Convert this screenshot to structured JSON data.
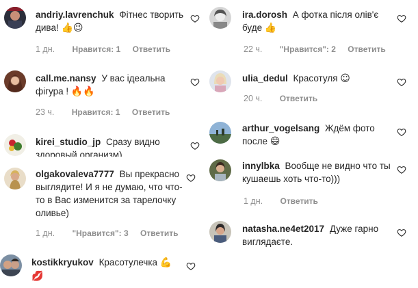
{
  "left": [
    {
      "username": "andriy.lavrenchuk",
      "text": "Фітнес творить дива!",
      "emoji": "👍😉",
      "time": "1 дн.",
      "likes": "Нравится: 1",
      "reply": "Ответить"
    },
    {
      "username": "call.me.nansy",
      "text": "У вас ідеальна фігура !",
      "emoji": "🔥🔥",
      "time": "23 ч.",
      "likes": "Нравится: 1",
      "reply": "Ответить"
    },
    {
      "username": "kirei_studio_jp",
      "text": "Сразу видно здоровый организм)"
    },
    {
      "username": "olgakovaleva7777",
      "text": "Вы прекрасно выглядите! И я не думаю, что что-то в Вас изменится за тарелочку оливье)",
      "time": "1 дн.",
      "likes": "\"Нравится\": 3",
      "reply": "Ответить"
    },
    {
      "username": "kostikkryukov",
      "text": "Красотулечка",
      "emoji": "💪💋"
    }
  ],
  "right": [
    {
      "username": "ira.dorosh",
      "text": "А фотка після олів'є буде",
      "emoji": "👍",
      "time": "22 ч.",
      "likes": "\"Нравится\": 2",
      "reply": "Ответить"
    },
    {
      "username": "ulia_dedul",
      "text": "Красотуля",
      "emoji": "☺",
      "time": "20 ч.",
      "reply": "Ответить"
    },
    {
      "username": "arthur_vogelsang",
      "text": "Ждём фото после",
      "emoji": "😄"
    },
    {
      "username": "innylbka",
      "text": "Вообще не видно что ты кушаешь хоть что-то)))",
      "time": "1 дн.",
      "reply": "Ответить"
    },
    {
      "username": "natasha.ne4et2017",
      "text": "Дуже гарно виглядаєте."
    }
  ],
  "colors": {
    "text": "#262626",
    "meta": "#8e8e8e",
    "heart_stroke": "#262626"
  }
}
